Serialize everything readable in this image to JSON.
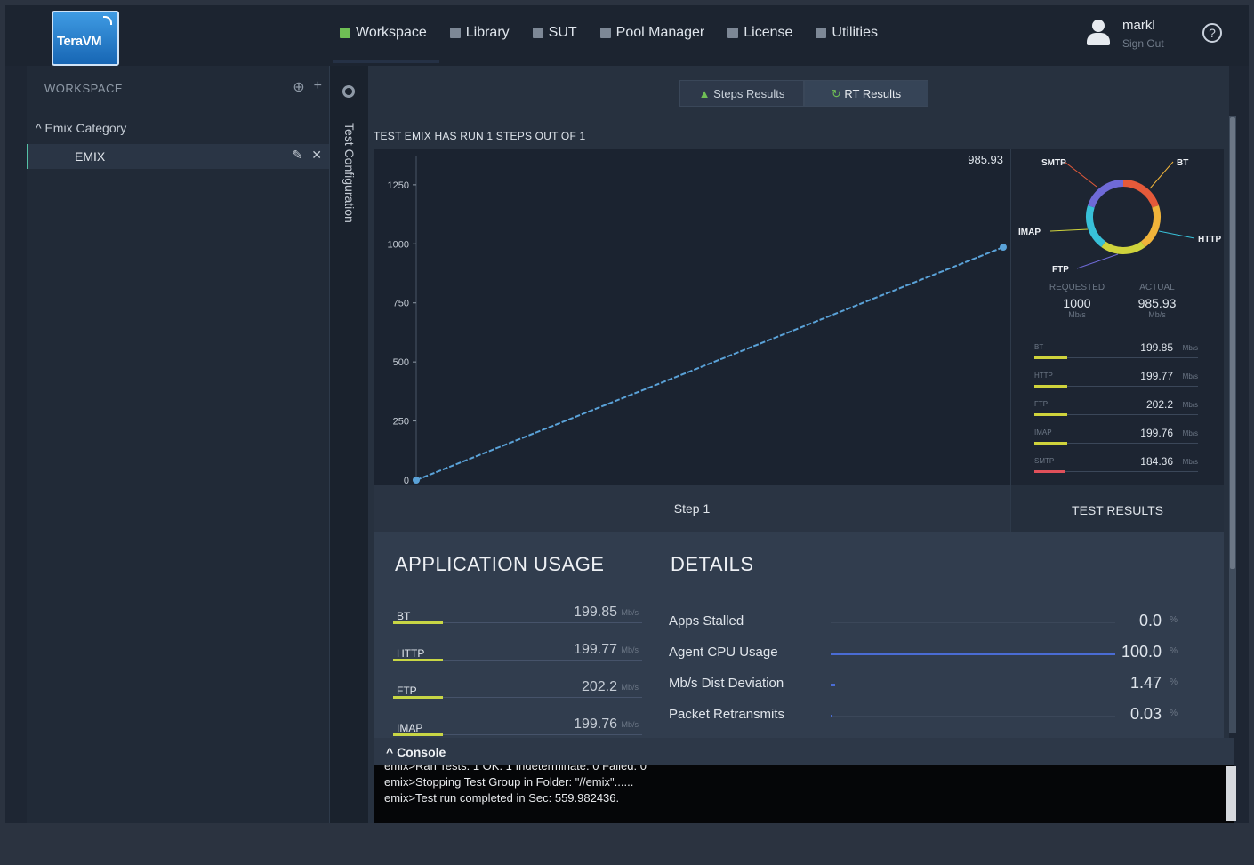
{
  "brand": {
    "logo_text": "TeraVM"
  },
  "nav": [
    {
      "label": "Workspace",
      "icon": "workspace-icon"
    },
    {
      "label": "Library",
      "icon": "library-icon"
    },
    {
      "label": "SUT",
      "icon": "sut-icon"
    },
    {
      "label": "Pool Manager",
      "icon": "pool-manager-icon"
    },
    {
      "label": "License",
      "icon": "license-icon"
    },
    {
      "label": "Utilities",
      "icon": "utilities-icon"
    }
  ],
  "user": {
    "name": "markl",
    "signout": "Sign Out",
    "help": "?"
  },
  "sidebar": {
    "title": "WORKSPACE",
    "category": "^ Emix Category",
    "item": "EMIX"
  },
  "vertical_tab": "Test Configuration",
  "tabs": {
    "steps": "Steps Results",
    "rt": "RT Results"
  },
  "run_status": "TEST EMIX HAS RUN 1 STEPS OUT OF 1",
  "chart_data": {
    "type": "line",
    "x": [
      0,
      1
    ],
    "values": [
      0,
      985.93
    ],
    "yticks": [
      0,
      250,
      500,
      750,
      1000,
      1250
    ],
    "ylim": [
      0,
      1370
    ],
    "end_label": "985.93",
    "color": "#5aa2d8"
  },
  "donut": {
    "labels": [
      "SMTP",
      "BT",
      "IMAP",
      "HTTP",
      "FTP"
    ],
    "colors": [
      "#e55a3a",
      "#f0b43a",
      "#cfd33c",
      "#38c0d8",
      "#6f6ad7"
    ]
  },
  "summary": {
    "requested_label": "REQUESTED",
    "requested_value": "1000",
    "requested_unit": "Mb/s",
    "actual_label": "ACTUAL",
    "actual_value": "985.93",
    "actual_unit": "Mb/s"
  },
  "side_stats": [
    {
      "name": "BT",
      "value": "199.85",
      "unit": "Mb/s",
      "color": "#cfd33c",
      "fraction": 0.2
    },
    {
      "name": "HTTP",
      "value": "199.77",
      "unit": "Mb/s",
      "color": "#cfd33c",
      "fraction": 0.2
    },
    {
      "name": "FTP",
      "value": "202.2",
      "unit": "Mb/s",
      "color": "#cfd33c",
      "fraction": 0.2
    },
    {
      "name": "IMAP",
      "value": "199.76",
      "unit": "Mb/s",
      "color": "#cfd33c",
      "fraction": 0.2
    },
    {
      "name": "SMTP",
      "value": "184.36",
      "unit": "Mb/s",
      "color": "#e0505a",
      "fraction": 0.19
    }
  ],
  "step_label": "Step 1",
  "results_tab": "TEST RESULTS",
  "usage": {
    "title": "APPLICATION USAGE",
    "rows": [
      {
        "name": "BT",
        "value": "199.85",
        "unit": "Mb/s"
      },
      {
        "name": "HTTP",
        "value": "199.77",
        "unit": "Mb/s"
      },
      {
        "name": "FTP",
        "value": "202.2",
        "unit": "Mb/s"
      },
      {
        "name": "IMAP",
        "value": "199.76",
        "unit": "Mb/s"
      }
    ]
  },
  "details": {
    "title": "DETAILS",
    "rows": [
      {
        "name": "Apps Stalled",
        "value": "0.0",
        "unit": "%",
        "fraction": 0
      },
      {
        "name": "Agent CPU Usage",
        "value": "100.0",
        "unit": "%",
        "fraction": 1.0
      },
      {
        "name": "Mb/s Dist Deviation",
        "value": "1.47",
        "unit": "%",
        "fraction": 0.0147
      },
      {
        "name": "Packet Retransmits",
        "value": "0.03",
        "unit": "%",
        "fraction": 0.0003
      }
    ]
  },
  "console": {
    "title": "^ Console",
    "lines": [
      "emix>Ran Tests: 1 OK: 1 Indeterminate: 0 Failed: 0",
      "emix>Stopping Test Group in Folder: \"//emix\"......",
      "emix>Test run completed in Sec: 559.982436."
    ]
  }
}
